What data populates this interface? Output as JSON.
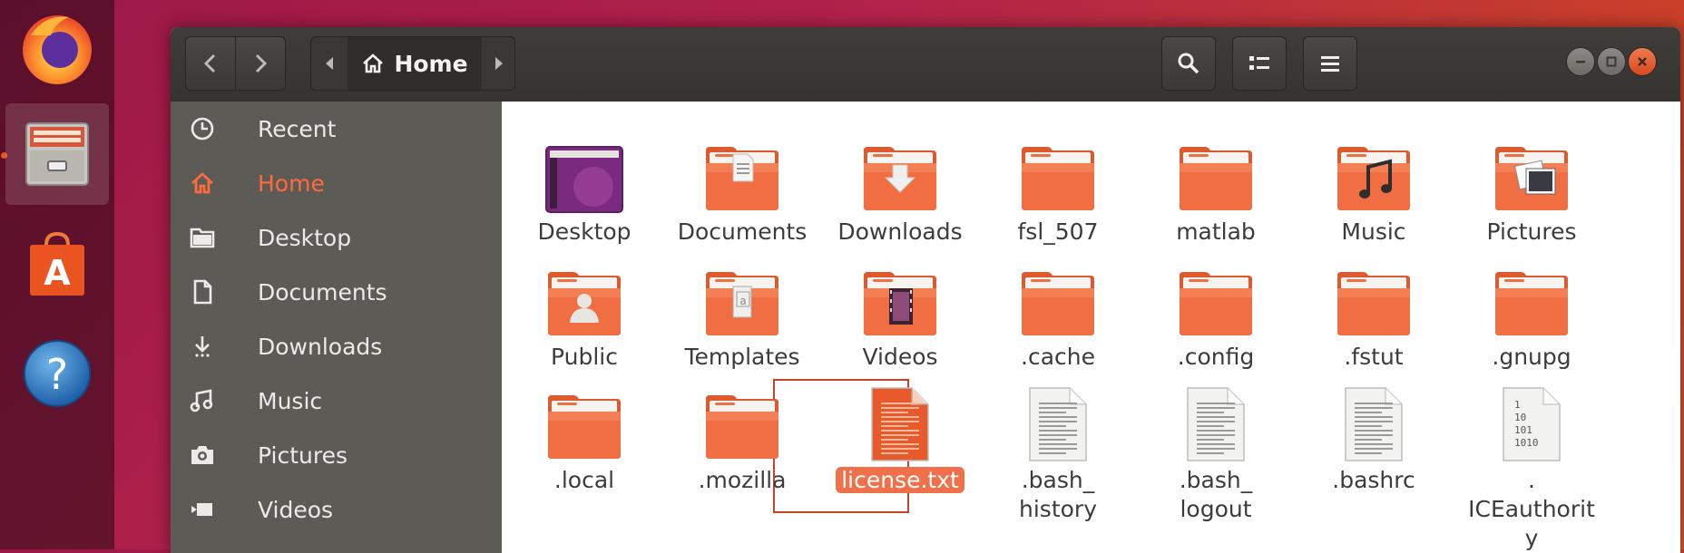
{
  "colors": {
    "accent": "#e95420",
    "folder": "#f06e42",
    "sidebar_bg": "#5d5b56",
    "headerbar_bg": "#3a3835"
  },
  "dock": {
    "apps": [
      {
        "name": "firefox",
        "icon": "firefox-icon"
      },
      {
        "name": "files",
        "icon": "files-icon",
        "active": true
      },
      {
        "name": "software",
        "icon": "software-center-icon"
      },
      {
        "name": "help",
        "icon": "help-icon",
        "glyph": "?"
      }
    ]
  },
  "headerbar": {
    "location": "Home",
    "buttons": [
      "back",
      "forward",
      "path-left",
      "path-right",
      "search",
      "view-list",
      "menu"
    ]
  },
  "sidebar": {
    "items": [
      {
        "label": "Recent",
        "icon": "clock-icon"
      },
      {
        "label": "Home",
        "icon": "home-icon",
        "selected": true
      },
      {
        "label": "Desktop",
        "icon": "folder-icon"
      },
      {
        "label": "Documents",
        "icon": "document-icon"
      },
      {
        "label": "Downloads",
        "icon": "download-icon"
      },
      {
        "label": "Music",
        "icon": "music-icon"
      },
      {
        "label": "Pictures",
        "icon": "camera-icon"
      },
      {
        "label": "Videos",
        "icon": "video-icon"
      }
    ]
  },
  "files": [
    {
      "name": "Desktop",
      "kind": "desktop"
    },
    {
      "name": "Documents",
      "kind": "folder-documents"
    },
    {
      "name": "Downloads",
      "kind": "folder-downloads"
    },
    {
      "name": "fsl_507",
      "kind": "folder"
    },
    {
      "name": "matlab",
      "kind": "folder"
    },
    {
      "name": "Music",
      "kind": "folder-music"
    },
    {
      "name": "Pictures",
      "kind": "folder-pictures"
    },
    {
      "name": "Public",
      "kind": "folder-public"
    },
    {
      "name": "Templates",
      "kind": "folder-templates"
    },
    {
      "name": "Videos",
      "kind": "folder-videos"
    },
    {
      "name": ".cache",
      "kind": "folder"
    },
    {
      "name": ".config",
      "kind": "folder"
    },
    {
      "name": ".fstut",
      "kind": "folder"
    },
    {
      "name": ".gnupg",
      "kind": "folder"
    },
    {
      "name": ".local",
      "kind": "folder"
    },
    {
      "name": ".mozilla",
      "kind": "folder"
    },
    {
      "name": "license.txt",
      "kind": "text-orange",
      "selected": true
    },
    {
      "name": ".bash_ history",
      "kind": "text"
    },
    {
      "name": ".bash_ logout",
      "kind": "text"
    },
    {
      "name": ".bashrc",
      "kind": "text"
    },
    {
      "name": ". ICEauthorit y",
      "kind": "binary"
    }
  ],
  "binary_glyph_lines": [
    "1",
    "10",
    "101",
    "1010"
  ]
}
